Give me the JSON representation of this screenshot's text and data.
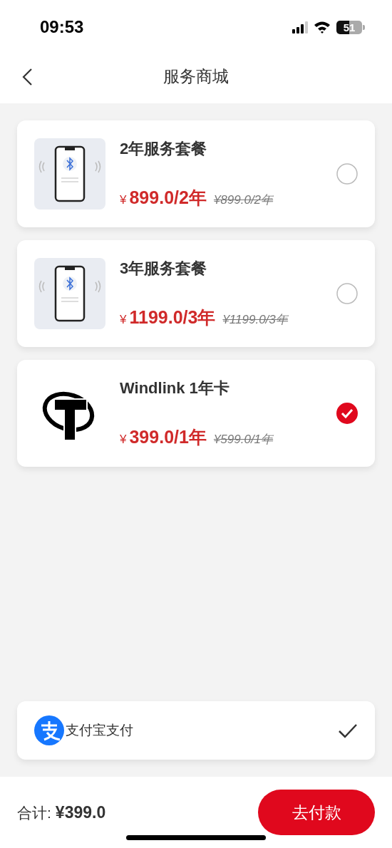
{
  "status_bar": {
    "time": "09:53",
    "battery": "51"
  },
  "nav": {
    "title": "服务商城"
  },
  "packages": [
    {
      "kind": "phone",
      "name": "2年服务套餐",
      "currency": "¥",
      "price": "899.0/2年",
      "original_price": "¥899.0/2年",
      "selected": false
    },
    {
      "kind": "phone",
      "name": "3年服务套餐",
      "currency": "¥",
      "price": "1199.0/3年",
      "original_price": "¥1199.0/3年",
      "selected": false
    },
    {
      "kind": "emblem",
      "name": "Windlink 1年卡",
      "currency": "¥",
      "price": "399.0/1年",
      "original_price": "¥599.0/1年",
      "selected": true
    }
  ],
  "payment": {
    "label": "支付宝支付",
    "checked": true
  },
  "footer": {
    "total_label": "合计:",
    "total": "¥399.0",
    "pay_button": "去付款"
  }
}
